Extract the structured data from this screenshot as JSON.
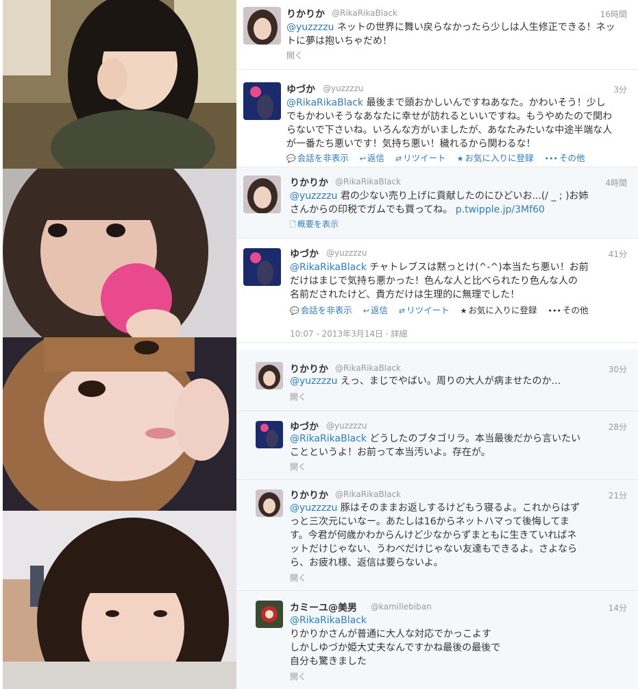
{
  "tweets": [
    {
      "name": "りかりか",
      "handle": "@RikaRikaBlack",
      "time": "16時間",
      "mention": "@yuzzzzu",
      "text1": " ネットの世界に舞い戻らなかったら少しは人生修正できる！ネッ",
      "text2": "トに夢は抱いちゃだめ！",
      "expand": "開く"
    },
    {
      "name": "ゆづか",
      "handle": "@yuzzzzu",
      "time": "3分",
      "mention": "@RikaRikaBlack",
      "text1": " 最後まで頭おかしいんですねあなた。かわいそう！少し",
      "text2": "でもかわいそうなあなたに幸せが訪れるといいですね。もうやめたので関わ",
      "text3": "らないで下さいね。いろんな方がいましたが、あなたみたいな中途半端な人",
      "text4": "が一番たち悪いです！気持ち悪い！穢れるから関わるな！",
      "actions": [
        "会話を非表示",
        "返信",
        "リツイート",
        "お気に入りに登録",
        "その他"
      ]
    },
    {
      "name": "りかりか",
      "handle": "@RikaRikaBlack",
      "time": "4時間",
      "mention": "@yuzzzzu",
      "text1": " 君の少ない売り上げに貢献したのにひどいお...(/ _ ; )お姉",
      "text2": "さんからの印税でガムでも買ってね。",
      "link": "p.twipple.jp/3Mf60",
      "summary": "概要を表示"
    },
    {
      "name": "ゆづか",
      "handle": "@yuzzzzu",
      "time": "41分",
      "mention": "@RikaRikaBlack",
      "text1": " チャトレブスは黙っとけ(^-^)本当たち悪い！お前",
      "text2": "だけはまじで気持ち悪かった！色んな人と比べられたり色んな人の",
      "text3": "名前だされたけど、貴方だけは生理的に無理でした！",
      "actions": [
        "会話を非表示",
        "返信",
        "リツイート",
        "お気に入りに登録",
        "その他"
      ],
      "meta": "10:07 - 2013年3月14日 · 詳細"
    },
    {
      "name": "りかりか",
      "handle": "@RikaRikaBlack",
      "time": "30分",
      "mention": "@yuzzzzu",
      "text1": " えっ、まじでやばい。周りの大人が病ませたのか…",
      "expand": "開く"
    },
    {
      "name": "ゆづか",
      "handle": "@yuzzzzu",
      "time": "28分",
      "mention": "@RikaRikaBlack",
      "text1": " どうしたのブタゴリラ。本当最後だから言いたい",
      "text2": "ことというよ！お前って本当汚いよ。存在が。",
      "expand": "開く"
    },
    {
      "name": "りかりか",
      "handle": "@RikaRikaBlack",
      "time": "21分",
      "mention": "@yuzzzzu",
      "text1": " 豚はそのままお返しするけどもう寝るよ。これからはず",
      "text2": "っと三次元にいなー。あたしは16からネットハマって後悔してま",
      "text3": "す。今君が何歳かわからんけど少なからずまともに生きていればネ",
      "text4": "ットだけじゃない、うわべだけじゃない友達もできるよ。さよなら",
      "text5": "ら、お疲れ様、返信は要らないよ。",
      "expand": "開く"
    },
    {
      "name": "カミーユ@美男",
      "handle": "@kamillebiban",
      "time": "14分",
      "mention": "@RikaRikaBlack",
      "text1": "",
      "text2": "りかりかさんが普通に大人な対応でかっこよす",
      "text3": "しかしゆづか姫大丈夫なんですかね最後の最後で",
      "text4": "自分も驚きました",
      "expand": "開く"
    }
  ]
}
